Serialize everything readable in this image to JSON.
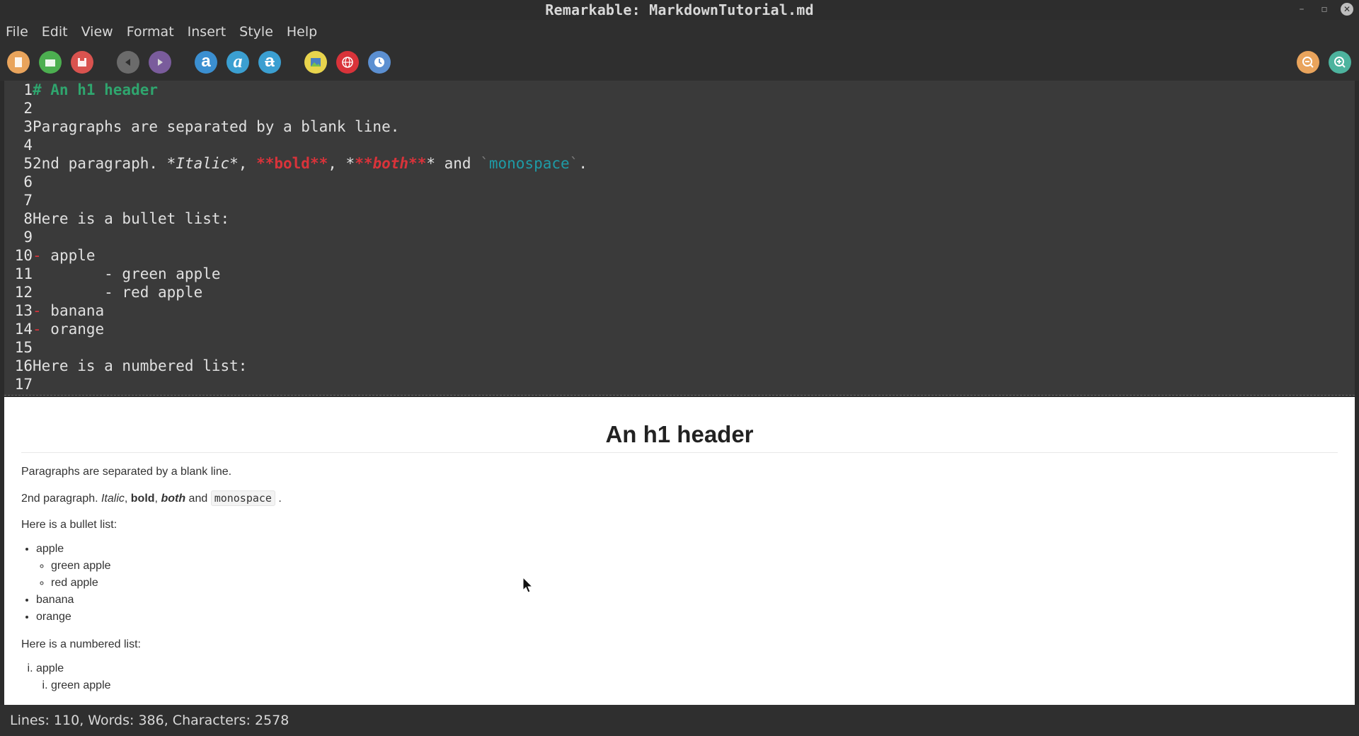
{
  "window": {
    "title": "Remarkable: MarkdownTutorial.md",
    "controls": [
      "–",
      "▫",
      "✕"
    ]
  },
  "menu": [
    "File",
    "Edit",
    "View",
    "Format",
    "Insert",
    "Style",
    "Help"
  ],
  "toolbar": {
    "colors": {
      "new": "#e9a45c",
      "open": "#4caf50",
      "save": "#d9534f",
      "undo": "#6b6b6b",
      "redo": "#7a5c9c",
      "bold": "#3b8fd1",
      "italic": "#3b9fd1",
      "strike": "#3b9fd1",
      "image": "#e8d44d",
      "link": "#d9333a",
      "timestamp": "#5b8fd1",
      "zoom_out": "#e9a45c",
      "zoom_in": "#4db39e"
    },
    "bold_glyph": "a",
    "italic_glyph": "a",
    "strike_glyph": "a"
  },
  "editor": {
    "lines": [
      {
        "n": "1"
      },
      {
        "n": "2"
      },
      {
        "n": "3"
      },
      {
        "n": "4"
      },
      {
        "n": "5"
      },
      {
        "n": "6"
      },
      {
        "n": "7"
      },
      {
        "n": "8"
      },
      {
        "n": "9"
      },
      {
        "n": "10"
      },
      {
        "n": "11"
      },
      {
        "n": "12"
      },
      {
        "n": "13"
      },
      {
        "n": "14"
      },
      {
        "n": "15"
      },
      {
        "n": "16"
      },
      {
        "n": "17"
      }
    ],
    "l1": "# An h1 header",
    "l3": "Paragraphs are separated by a blank line.",
    "l5": {
      "pre": "2nd paragraph. *",
      "italic": "Italic",
      "mid1": "*, ",
      "bold": "**bold**",
      "mid2": ", *",
      "both": "**both**",
      "mid3": "* and ",
      "tick1": "`",
      "mono": "monospace",
      "tick2": "`",
      "end": "."
    },
    "l8": "Here is a bullet list:",
    "l10": {
      "dash": "-",
      "text": " apple"
    },
    "l11": "        - green apple",
    "l12": "        - red apple",
    "l13": {
      "dash": "-",
      "text": " banana"
    },
    "l14": {
      "dash": "-",
      "text": " orange"
    },
    "l16": "Here is a numbered list:"
  },
  "preview": {
    "h1": "An h1 header",
    "p1": "Paragraphs are separated by a blank line.",
    "p2": {
      "pre": "2nd paragraph. ",
      "italic": "Italic",
      "c1": ", ",
      "bold": "bold",
      "c2": ", ",
      "both": "both",
      "and": " and ",
      "mono": "monospace",
      "end": " ."
    },
    "p3": "Here is a bullet list:",
    "bullets": {
      "apple": "apple",
      "green": "green apple",
      "red": "red apple",
      "banana": "banana",
      "orange": "orange"
    },
    "p4": "Here is a numbered list:",
    "numbered": {
      "apple": "apple",
      "green": "green apple"
    }
  },
  "status": "Lines: 110, Words: 386, Characters: 2578"
}
